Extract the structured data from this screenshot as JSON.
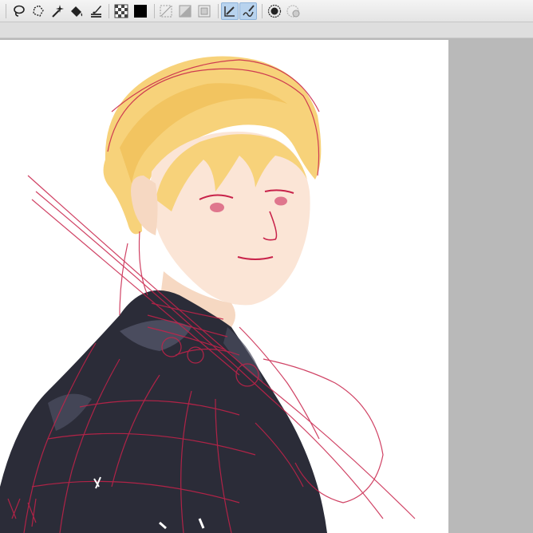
{
  "toolbar": {
    "tools": [
      {
        "name": "lasso-tool-icon",
        "active": false
      },
      {
        "name": "polyline-selection-icon",
        "active": false
      },
      {
        "name": "magic-wand-icon",
        "active": false
      },
      {
        "name": "fill-bucket-icon",
        "active": false
      },
      {
        "name": "brush-settings-icon",
        "active": false
      },
      {
        "name": "transparent-color-icon",
        "active": false
      },
      {
        "name": "black-color-swatch-icon",
        "active": false
      },
      {
        "name": "clear-selection-icon",
        "active": false
      },
      {
        "name": "invert-selection-icon",
        "active": false
      },
      {
        "name": "select-all-icon",
        "active": false
      },
      {
        "name": "pen-stabilizer-icon",
        "active": true
      },
      {
        "name": "vector-brush-icon",
        "active": true
      },
      {
        "name": "record-icon",
        "active": false
      },
      {
        "name": "color-mixer-icon",
        "active": false
      }
    ]
  },
  "colors": {
    "hair": "#f7d27a",
    "hair_shadow": "#f0be55",
    "skin": "#fbe5d6",
    "sketch": "#c8224a",
    "coat": "#2b2c38",
    "coat_light": "#4a4c5e",
    "canvas": "#ffffff",
    "workspace": "#b9b9b9"
  }
}
